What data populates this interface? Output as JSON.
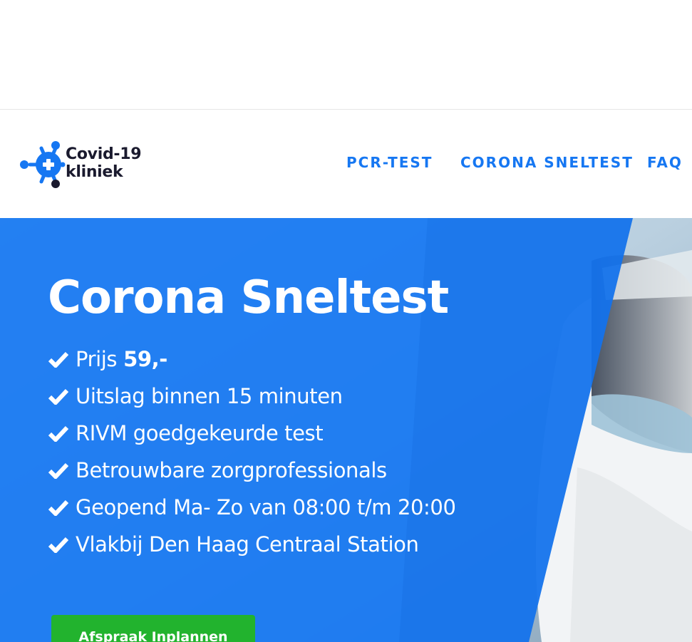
{
  "brand": {
    "name_line1": "Covid-19",
    "name_line2": "kliniek",
    "logo_icon": "virus-cross-icon",
    "color_blue": "#1677f2",
    "color_dark": "#1a1a2e"
  },
  "nav": {
    "items": [
      {
        "label": "PCR-TEST"
      },
      {
        "label": "CORONA SNELTEST"
      },
      {
        "label": "FAQ"
      }
    ],
    "color": "#1677f2"
  },
  "hero": {
    "title": "Corona Sneltest",
    "price_label": "Prijs",
    "price_value": "59,-",
    "features": [
      "Uitslag binnen 15 minuten",
      "RIVM goedgekeurde test",
      "Betrouwbare zorgprofessionals",
      "Geopend Ma- Zo van 08:00 t/m 20:00",
      "Vlakbij Den Haag Centraal Station"
    ],
    "feature_icon": "check-icon",
    "cta_label": "Afspraak Inplannen",
    "cta_color": "#22b32e"
  }
}
